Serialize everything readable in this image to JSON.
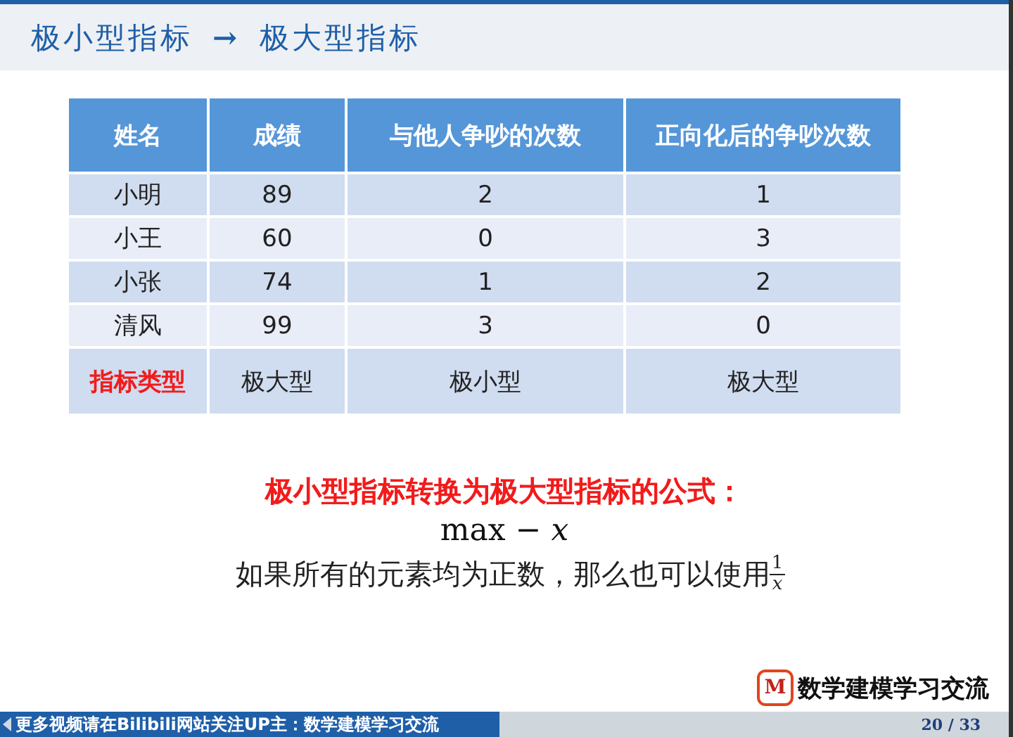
{
  "slide": {
    "title_from": "极小型指标",
    "title_arrow": "→",
    "title_to": "极大型指标",
    "table": {
      "columns": [
        "姓名",
        "成绩",
        "与他人争吵的次数",
        "正向化后的争吵次数"
      ],
      "rows": [
        {
          "kind": "data",
          "cells": [
            "小明",
            "89",
            "2",
            "1"
          ]
        },
        {
          "kind": "data",
          "cells": [
            "小王",
            "60",
            "0",
            "3"
          ]
        },
        {
          "kind": "data",
          "cells": [
            "小张",
            "74",
            "1",
            "2"
          ]
        },
        {
          "kind": "data",
          "cells": [
            "清风",
            "99",
            "3",
            "0"
          ]
        },
        {
          "kind": "type",
          "cells": [
            "指标类型",
            "极大型",
            "极小型",
            "极大型"
          ]
        }
      ]
    },
    "heading": "极小型指标转换为极大型指标的公式：",
    "formula": "max − *x*",
    "note": "如果所有的元素均为正数，那么也可以使用",
    "fraction": {
      "numerator": "1",
      "denominator": "x"
    },
    "logo_letter": "M",
    "logo_text": "数学建模学习交流"
  },
  "footer": {
    "caption": "更多视频请在Bilibili网站关注UP主：数学建模学习交流",
    "page": "20 / 33"
  }
}
